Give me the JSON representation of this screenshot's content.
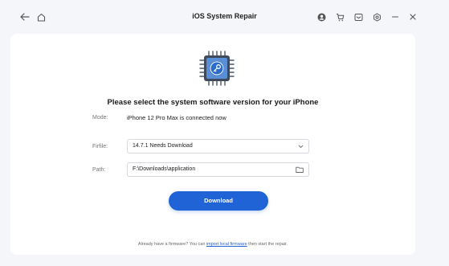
{
  "window": {
    "title": "iOS System Repair"
  },
  "titlebar_icons": [
    "back-arrow-icon",
    "home-icon",
    "account-icon",
    "cart-icon",
    "mail-icon",
    "settings-icon",
    "minimize-icon",
    "close-icon"
  ],
  "heading": "Please select the system software version for your iPhone",
  "mode": {
    "label": "Mode:",
    "value": "iPhone 12 Pro Max is connected now"
  },
  "firmware": {
    "label": "Firfile:",
    "value": "14.7.1 Needs Download"
  },
  "path": {
    "label": "Path:",
    "value": "F:\\Downloads\\application"
  },
  "download_button": "Download",
  "footer": {
    "before": "Already have a firmware? You can",
    "link": "import local firmware",
    "after": "then start the repair."
  },
  "colors": {
    "accent": "#1f63d6",
    "chip_body": "#5a8fd6",
    "chip_core": "#2a6bd0"
  }
}
